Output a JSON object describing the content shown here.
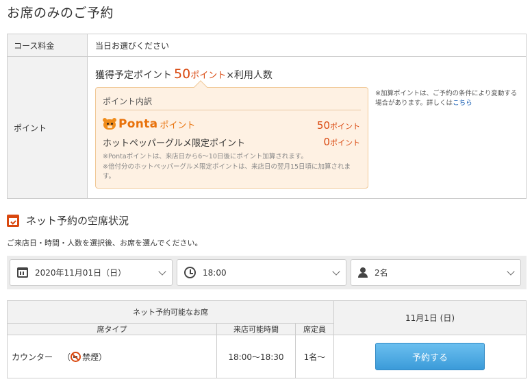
{
  "page_title": "お席のみのご予約",
  "info": {
    "course_label": "コース料金",
    "course_value": "当日お選びください",
    "points_label": "ポイント",
    "earn_prefix": "獲得予定ポイント",
    "earn_value": "50",
    "earn_unit": "ポイント",
    "earn_suffix": "×利用人数",
    "breakdown_title": "ポイント内訳",
    "ponta_logo_text": "Ponta",
    "ponta_suffix": "ポイント",
    "ponta_value": "50",
    "ponta_unit": "ポイント",
    "gourmet_label": "ホットペッパーグルメ限定ポイント",
    "gourmet_value": "0",
    "gourmet_unit": "ポイント",
    "note1": "※Pontaポイントは、来店日から6〜10日後にポイント加算されます。",
    "note2": "※倍付分のホットペッパーグルメ限定ポイントは、来店日の翌月15日頃に加算されます。",
    "side_note": "※加算ポイントは、ご予約の条件により変動する場合があります。詳しくは",
    "side_link": "こちら"
  },
  "vacancy": {
    "title": "ネット予約の空席状況",
    "description": "ご来店日・時間・人数を選択後、お席を選んでください。"
  },
  "filters": {
    "date": "2020年11月01日（日）",
    "time": "18:00",
    "people": "2名"
  },
  "table": {
    "group_header": "ネット予約可能なお席",
    "col_type": "席タイプ",
    "col_time": "来店可能時間",
    "col_capacity": "席定員",
    "date_header": "11月1日 (日)",
    "rows": [
      {
        "type": "カウンター",
        "paren_open": "（",
        "smoking": "禁煙",
        "paren_close": "）",
        "time": "18:00〜18:30",
        "capacity": "1名〜",
        "button": "予約する"
      }
    ]
  },
  "colors": {
    "accent": "#d9480f",
    "button": "#4aa8e0",
    "breakdown_bg": "#fef1e3"
  }
}
